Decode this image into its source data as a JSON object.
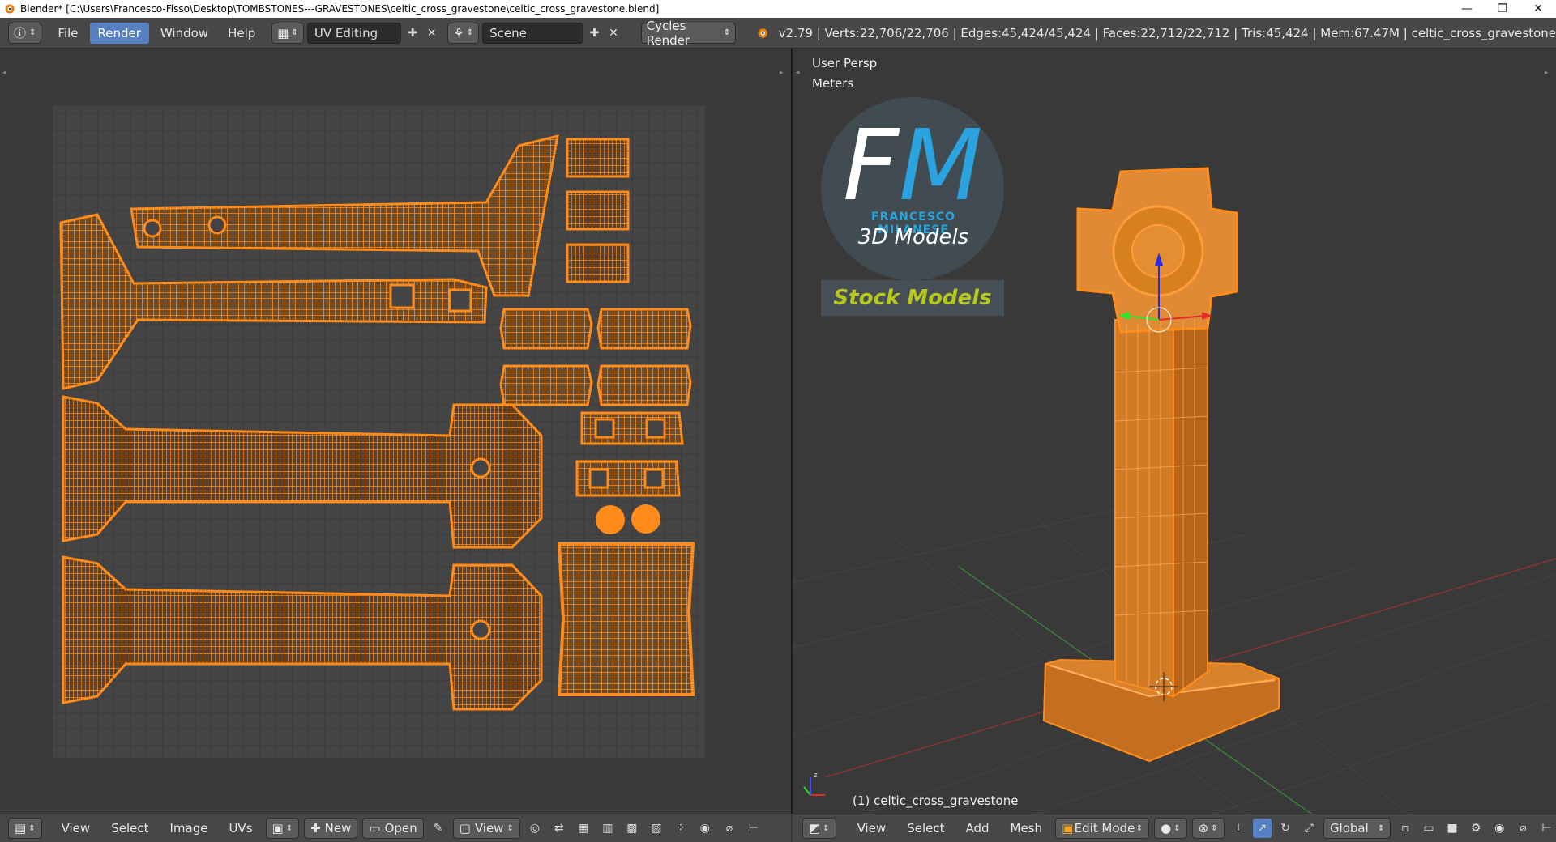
{
  "window": {
    "title": "Blender* [C:\\Users\\Francesco-Fisso\\Desktop\\TOMBSTONES---GRAVESTONES\\celtic_cross_gravestone\\celtic_cross_gravestone.blend]",
    "minimize": "—",
    "maximize": "❐",
    "close": "✕"
  },
  "menu": {
    "items": [
      "File",
      "Render",
      "Window",
      "Help"
    ],
    "active": "Render",
    "layout": "UV Editing",
    "scene": "Scene",
    "engine": "Cycles Render"
  },
  "stats": "v2.79 | Verts:22,706/22,706 | Edges:45,424/45,424 | Faces:22,712/22,712 | Tris:45,424 | Mem:67.47M | celtic_cross_gravestone",
  "viewport": {
    "view_name": "User Persp",
    "units": "Meters",
    "object_label": "(1) celtic_cross_gravestone"
  },
  "logo": {
    "f": "F",
    "m": "M",
    "subtitle": "FRANCESCO MILANESE",
    "line2": "3D Models",
    "stock": "Stock Models"
  },
  "uv_header": {
    "menus": [
      "View",
      "Select",
      "Image",
      "UVs"
    ],
    "new": "New",
    "open": "Open",
    "view": "View"
  },
  "view3d_header": {
    "menus": [
      "View",
      "Select",
      "Add",
      "Mesh"
    ],
    "mode": "Edit Mode",
    "orientation": "Global"
  },
  "colors": {
    "mesh": "#ff8c1a",
    "mesh_dark": "#c85f00",
    "accent": "#5680c2"
  }
}
